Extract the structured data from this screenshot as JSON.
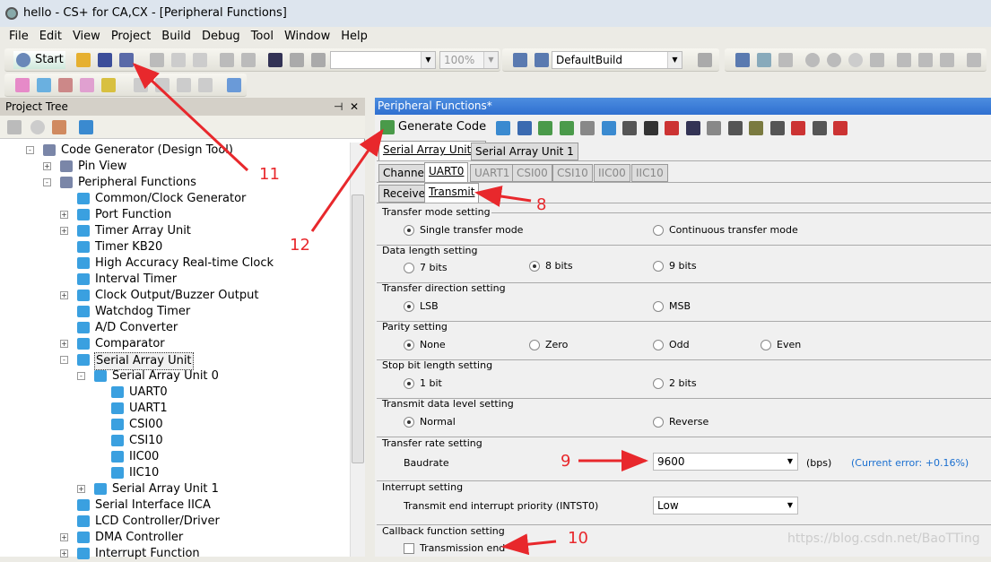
{
  "title": "hello - CS+ for CA,CX - [Peripheral Functions]",
  "menu": [
    "File",
    "Edit",
    "View",
    "Project",
    "Build",
    "Debug",
    "Tool",
    "Window",
    "Help"
  ],
  "toolbar": {
    "start": "Start",
    "zoom": "100%",
    "build_config": "DefaultBuild"
  },
  "project_tree": {
    "title": "Project Tree",
    "pin": "⊣",
    "close": "✕",
    "items": [
      {
        "label": "Code Generator (Design Tool)",
        "level": 0,
        "expander": "-"
      },
      {
        "label": "Pin View",
        "level": 1,
        "expander": "+"
      },
      {
        "label": "Peripheral Functions",
        "level": 1,
        "expander": "-"
      },
      {
        "label": "Common/Clock Generator",
        "level": 2,
        "expander": ""
      },
      {
        "label": "Port Function",
        "level": 2,
        "expander": "+"
      },
      {
        "label": "Timer Array Unit",
        "level": 2,
        "expander": "+"
      },
      {
        "label": "Timer KB20",
        "level": 2,
        "expander": ""
      },
      {
        "label": "High Accuracy Real-time Clock",
        "level": 2,
        "expander": ""
      },
      {
        "label": "Interval Timer",
        "level": 2,
        "expander": ""
      },
      {
        "label": "Clock Output/Buzzer Output",
        "level": 2,
        "expander": "+"
      },
      {
        "label": "Watchdog Timer",
        "level": 2,
        "expander": ""
      },
      {
        "label": "A/D Converter",
        "level": 2,
        "expander": ""
      },
      {
        "label": "Comparator",
        "level": 2,
        "expander": "+"
      },
      {
        "label": "Serial Array Unit",
        "level": 2,
        "expander": "-",
        "selected": true
      },
      {
        "label": "Serial Array Unit 0",
        "level": 3,
        "expander": "-"
      },
      {
        "label": "UART0",
        "level": 4,
        "expander": ""
      },
      {
        "label": "UART1",
        "level": 4,
        "expander": ""
      },
      {
        "label": "CSI00",
        "level": 4,
        "expander": ""
      },
      {
        "label": "CSI10",
        "level": 4,
        "expander": ""
      },
      {
        "label": "IIC00",
        "level": 4,
        "expander": ""
      },
      {
        "label": "IIC10",
        "level": 4,
        "expander": ""
      },
      {
        "label": "Serial Array Unit 1",
        "level": 3,
        "expander": "+"
      },
      {
        "label": "Serial Interface IICA",
        "level": 2,
        "expander": ""
      },
      {
        "label": "LCD Controller/Driver",
        "level": 2,
        "expander": ""
      },
      {
        "label": "DMA Controller",
        "level": 2,
        "expander": "+"
      },
      {
        "label": "Interrupt Function",
        "level": 2,
        "expander": "+"
      }
    ]
  },
  "panel": {
    "title": "Peripheral Functions*",
    "generate_code": "Generate Code",
    "unit_tabs": [
      "Serial Array Unit 0",
      "Serial Array Unit 1"
    ],
    "channel_tabs": [
      "Channel",
      "UART0",
      "UART1",
      "CSI00",
      "CSI10",
      "IIC00",
      "IIC10"
    ],
    "dir_tabs": [
      "Receive",
      "Transmit"
    ],
    "groups": {
      "transfer_mode": {
        "title": "Transfer mode setting",
        "options": [
          "Single transfer mode",
          "Continuous transfer mode"
        ],
        "selected": 0
      },
      "data_length": {
        "title": "Data length setting",
        "options": [
          "7 bits",
          "8 bits",
          "9 bits"
        ],
        "selected": 1
      },
      "direction": {
        "title": "Transfer direction setting",
        "options": [
          "LSB",
          "MSB"
        ],
        "selected": 0
      },
      "parity": {
        "title": "Parity setting",
        "options": [
          "None",
          "Zero",
          "Odd",
          "Even"
        ],
        "selected": 0
      },
      "stop_bit": {
        "title": "Stop bit length setting",
        "options": [
          "1 bit",
          "2 bits"
        ],
        "selected": 0
      },
      "data_level": {
        "title": "Transmit data level setting",
        "options": [
          "Normal",
          "Reverse"
        ],
        "selected": 0
      },
      "rate": {
        "title": "Transfer rate setting",
        "label": "Baudrate",
        "value": "9600",
        "unit": "(bps)",
        "error": "(Current error: +0.16%)"
      },
      "interrupt": {
        "title": "Interrupt setting",
        "label": "Transmit end interrupt priority (INTST0)",
        "value": "Low"
      },
      "callback": {
        "title": "Callback function setting",
        "label": "Transmission end",
        "checked": false
      }
    }
  },
  "annotations": [
    "8",
    "9",
    "10",
    "11",
    "12"
  ],
  "watermark": "https://blog.csdn.net/BaoTTing",
  "colors": {
    "annotation": "#e8282c",
    "panel_header": "#3a7bd8",
    "error_text": "#1a6fd0"
  }
}
